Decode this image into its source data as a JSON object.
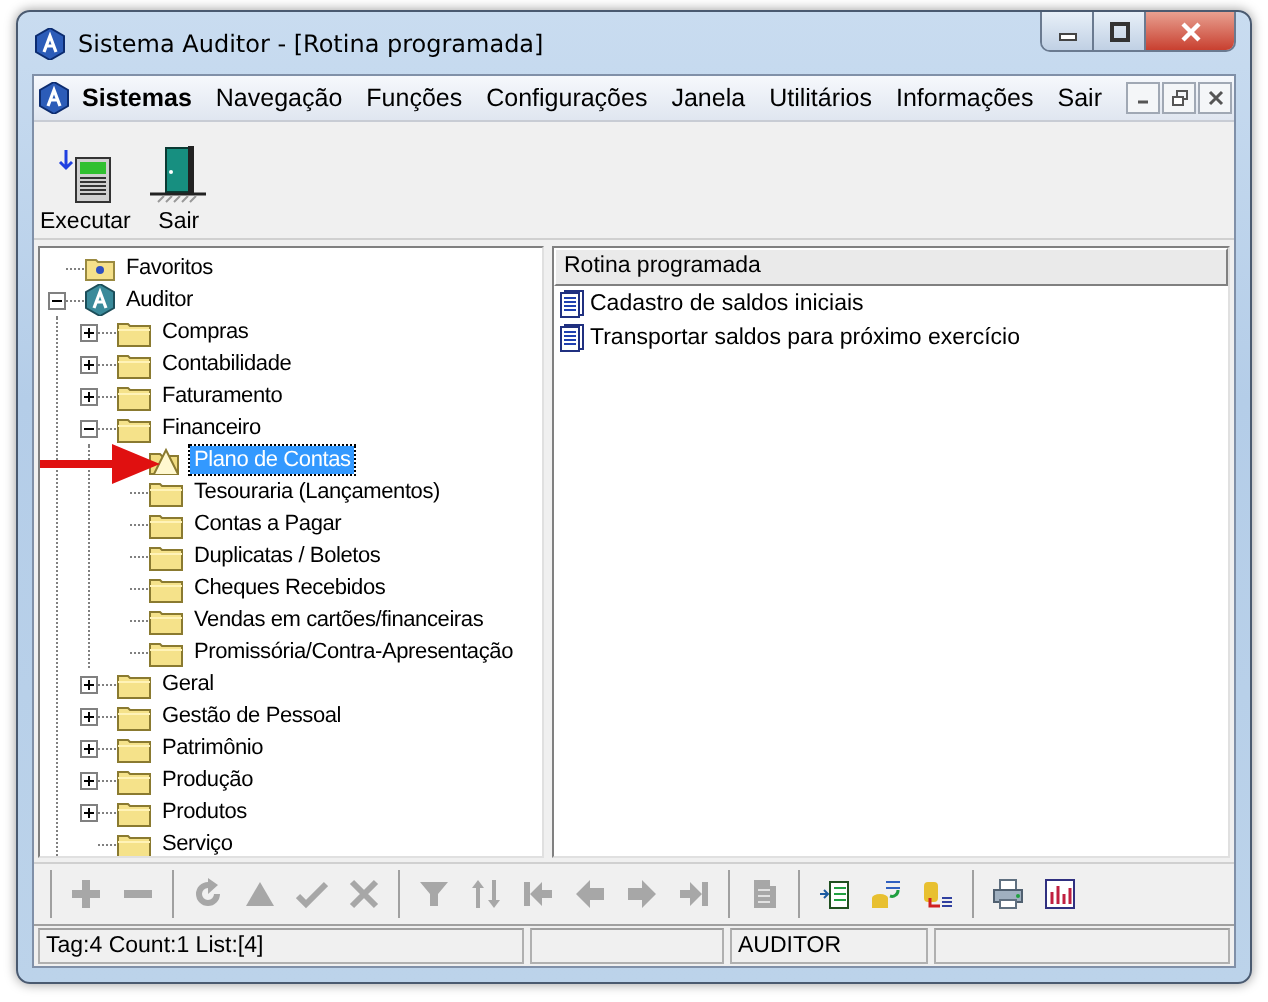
{
  "window": {
    "title": "Sistema Auditor - [Rotina programada]"
  },
  "menu": {
    "app": "Sistemas",
    "items": [
      "Navegação",
      "Funções",
      "Configurações",
      "Janela",
      "Utilitários",
      "Informações",
      "Sair"
    ]
  },
  "toolbar": [
    {
      "kind": "run",
      "label": "Executar"
    },
    {
      "kind": "exit",
      "label": "Sair"
    }
  ],
  "tree": [
    {
      "label": "Favoritos",
      "kind": "favorites",
      "selected": false
    },
    {
      "label": "Auditor",
      "kind": "app",
      "expanded": true,
      "selected": false,
      "children": [
        {
          "label": "Compras",
          "kind": "folder",
          "expanded": false,
          "selected": false
        },
        {
          "label": "Contabilidade",
          "kind": "folder",
          "expanded": false,
          "selected": false
        },
        {
          "label": "Faturamento",
          "kind": "folder",
          "expanded": false,
          "selected": false
        },
        {
          "label": "Financeiro",
          "kind": "folder",
          "expanded": true,
          "selected": false,
          "children": [
            {
              "label": "Plano de Contas",
              "kind": "folder_open",
              "selected": true
            },
            {
              "label": "Tesouraria (Lançamentos)",
              "kind": "folder",
              "selected": false
            },
            {
              "label": "Contas a Pagar",
              "kind": "folder",
              "selected": false
            },
            {
              "label": "Duplicatas / Boletos",
              "kind": "folder",
              "selected": false
            },
            {
              "label": "Cheques Recebidos",
              "kind": "folder",
              "selected": false
            },
            {
              "label": "Vendas em cartões/financeiras",
              "kind": "folder",
              "selected": false
            },
            {
              "label": "Promissória/Contra-Apresentação",
              "kind": "folder",
              "selected": false
            }
          ]
        },
        {
          "label": "Geral",
          "kind": "folder",
          "expanded": false,
          "selected": false
        },
        {
          "label": "Gestão de Pessoal",
          "kind": "folder",
          "expanded": false,
          "selected": false
        },
        {
          "label": "Patrimônio",
          "kind": "folder",
          "expanded": false,
          "selected": false
        },
        {
          "label": "Produção",
          "kind": "folder",
          "expanded": false,
          "selected": false
        },
        {
          "label": "Produtos",
          "kind": "folder",
          "expanded": false,
          "selected": false
        },
        {
          "label": "Serviço",
          "kind": "folder",
          "selected": false
        }
      ]
    }
  ],
  "list": {
    "header": "Rotina programada",
    "items": [
      "Cadastro de saldos iniciais",
      "Transportar saldos para próximo exercício"
    ]
  },
  "bottom_toolbar": [
    [
      {
        "kind": "add",
        "disabled": true
      },
      {
        "kind": "remove",
        "disabled": true
      }
    ],
    [
      {
        "kind": "refresh",
        "disabled": true
      },
      {
        "kind": "up",
        "disabled": true
      },
      {
        "kind": "confirm",
        "disabled": true
      },
      {
        "kind": "cancel",
        "disabled": true
      }
    ],
    [
      {
        "kind": "filter",
        "disabled": true
      },
      {
        "kind": "sort",
        "disabled": true
      },
      {
        "kind": "first",
        "disabled": true
      },
      {
        "kind": "prev",
        "disabled": true
      },
      {
        "kind": "next",
        "disabled": true
      },
      {
        "kind": "last",
        "disabled": true
      }
    ],
    [
      {
        "kind": "copy",
        "disabled": true
      }
    ],
    [
      {
        "kind": "export",
        "disabled": false
      },
      {
        "kind": "transfer",
        "disabled": false
      },
      {
        "kind": "import",
        "disabled": false
      }
    ],
    [
      {
        "kind": "print",
        "disabled": false
      },
      {
        "kind": "report",
        "disabled": false
      }
    ]
  ],
  "status_bar": {
    "info": "Tag:4 Count:1 List:[4]",
    "user": "AUDITOR"
  }
}
